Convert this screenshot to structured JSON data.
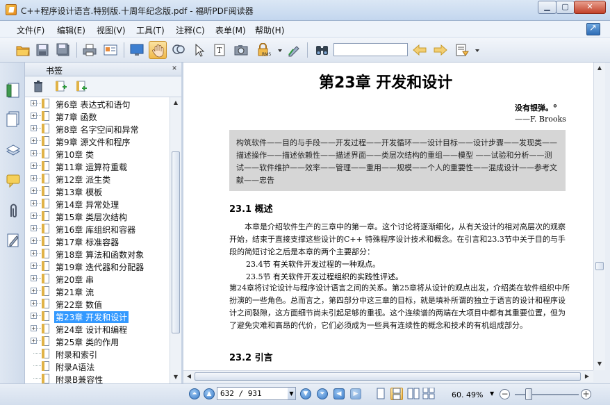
{
  "window": {
    "title": "C++程序设计语言.特别版.十周年纪念版.pdf - 福昕PDF阅读器",
    "minimize_label": "▁",
    "maximize_label": "▢",
    "close_label": "✕"
  },
  "menu": {
    "items": [
      {
        "label": "文件(F)"
      },
      {
        "label": "编辑(E)"
      },
      {
        "label": "视图(V)"
      },
      {
        "label": "工具(T)"
      },
      {
        "label": "注释(C)"
      },
      {
        "label": "表单(M)"
      },
      {
        "label": "帮助(H)"
      }
    ]
  },
  "toolbar": {
    "search_value": "",
    "active_tool": "hand-tool"
  },
  "bookmarks": {
    "title": "书签",
    "close_label": "✕",
    "items": [
      {
        "label": "第6章 表达式和语句",
        "expandable": true
      },
      {
        "label": "第7章 函数",
        "expandable": true
      },
      {
        "label": "第8章 名字空间和异常",
        "expandable": true
      },
      {
        "label": "第9章 源文件和程序",
        "expandable": true
      },
      {
        "label": "第10章 类",
        "expandable": true
      },
      {
        "label": "第11章 运算符重载",
        "expandable": true
      },
      {
        "label": "第12章 派生类",
        "expandable": true
      },
      {
        "label": "第13章 模板",
        "expandable": true
      },
      {
        "label": "第14章 异常处理",
        "expandable": true
      },
      {
        "label": "第15章 类层次结构",
        "expandable": true
      },
      {
        "label": "第16章 库组织和容器",
        "expandable": true
      },
      {
        "label": "第17章 标准容器",
        "expandable": true
      },
      {
        "label": "第18章 算法和函数对象",
        "expandable": true
      },
      {
        "label": "第19章 迭代器和分配器",
        "expandable": true
      },
      {
        "label": "第20章 串",
        "expandable": true
      },
      {
        "label": "第21章 流",
        "expandable": true
      },
      {
        "label": "第22章 数值",
        "expandable": true
      },
      {
        "label": "第23章 开发和设计",
        "expandable": true,
        "selected": true
      },
      {
        "label": "第24章 设计和编程",
        "expandable": true
      },
      {
        "label": "第25章 类的作用",
        "expandable": true
      },
      {
        "label": "附录和索引",
        "expandable": false
      },
      {
        "label": "附录A语法",
        "expandable": false
      },
      {
        "label": "附录B兼容性",
        "expandable": false
      }
    ]
  },
  "document": {
    "chapter_title": "第23章  开发和设计",
    "quote_text": "没有银弹。",
    "quote_footnote_mark": "⊖",
    "quote_author": "——F. Brooks",
    "summary_box": "构筑软件——目的与手段——开发过程——开发循环——设计目标——设计步骤——发现类——描述操作——描述依赖性——描述界面——类层次结构的重组——模型 ——试验和分析——测试——软件维护——效率——管理——重用——规模——个人的重要性——混成设计——参考文献——忠告",
    "section1_heading": "23.1  概述",
    "para1": "本章是介绍软件生产的三章中的第一章。这个讨论将逐渐细化，从有关设计的相对高层次的观察开始，结束于直接支撑这些设计的C++ 特殊程序设计技术和概念。在引言和23.3节中关于目的与手段的简短讨论之后是本章的两个主要部分：",
    "list1": "23.4节  有关软件开发过程的一种观点。",
    "list2": "23.5节  有关软件开发过程组织的实践性评述。",
    "para2": "第24章将讨论设计与程序设计语言之间的关系。第25章将从设计的观点出发，介绍类在软件组织中所扮演的一些角色。总而言之，第四部分中这三章的目标，就是填补所谓的独立于语言的设计和程序设计之间裂隙，这方面细节尚未引起足够的重视。这个连续谱的两端在大项目中都有其重要位置，但为了避免灾难和高昂的代价，它们必须成为一些具有连续性的概念和技术的有机组成部分。",
    "section2_heading": "23.2  引言"
  },
  "status": {
    "page_display": "632 / 931",
    "current_page": 632,
    "total_pages": 931,
    "zoom_text": "60. 49%",
    "zoom_fraction": 0.22
  },
  "colors": {
    "selection": "#3399ff",
    "summary_box_bg": "#d6d6d6",
    "active_tool_bg": "#f0b94a"
  }
}
